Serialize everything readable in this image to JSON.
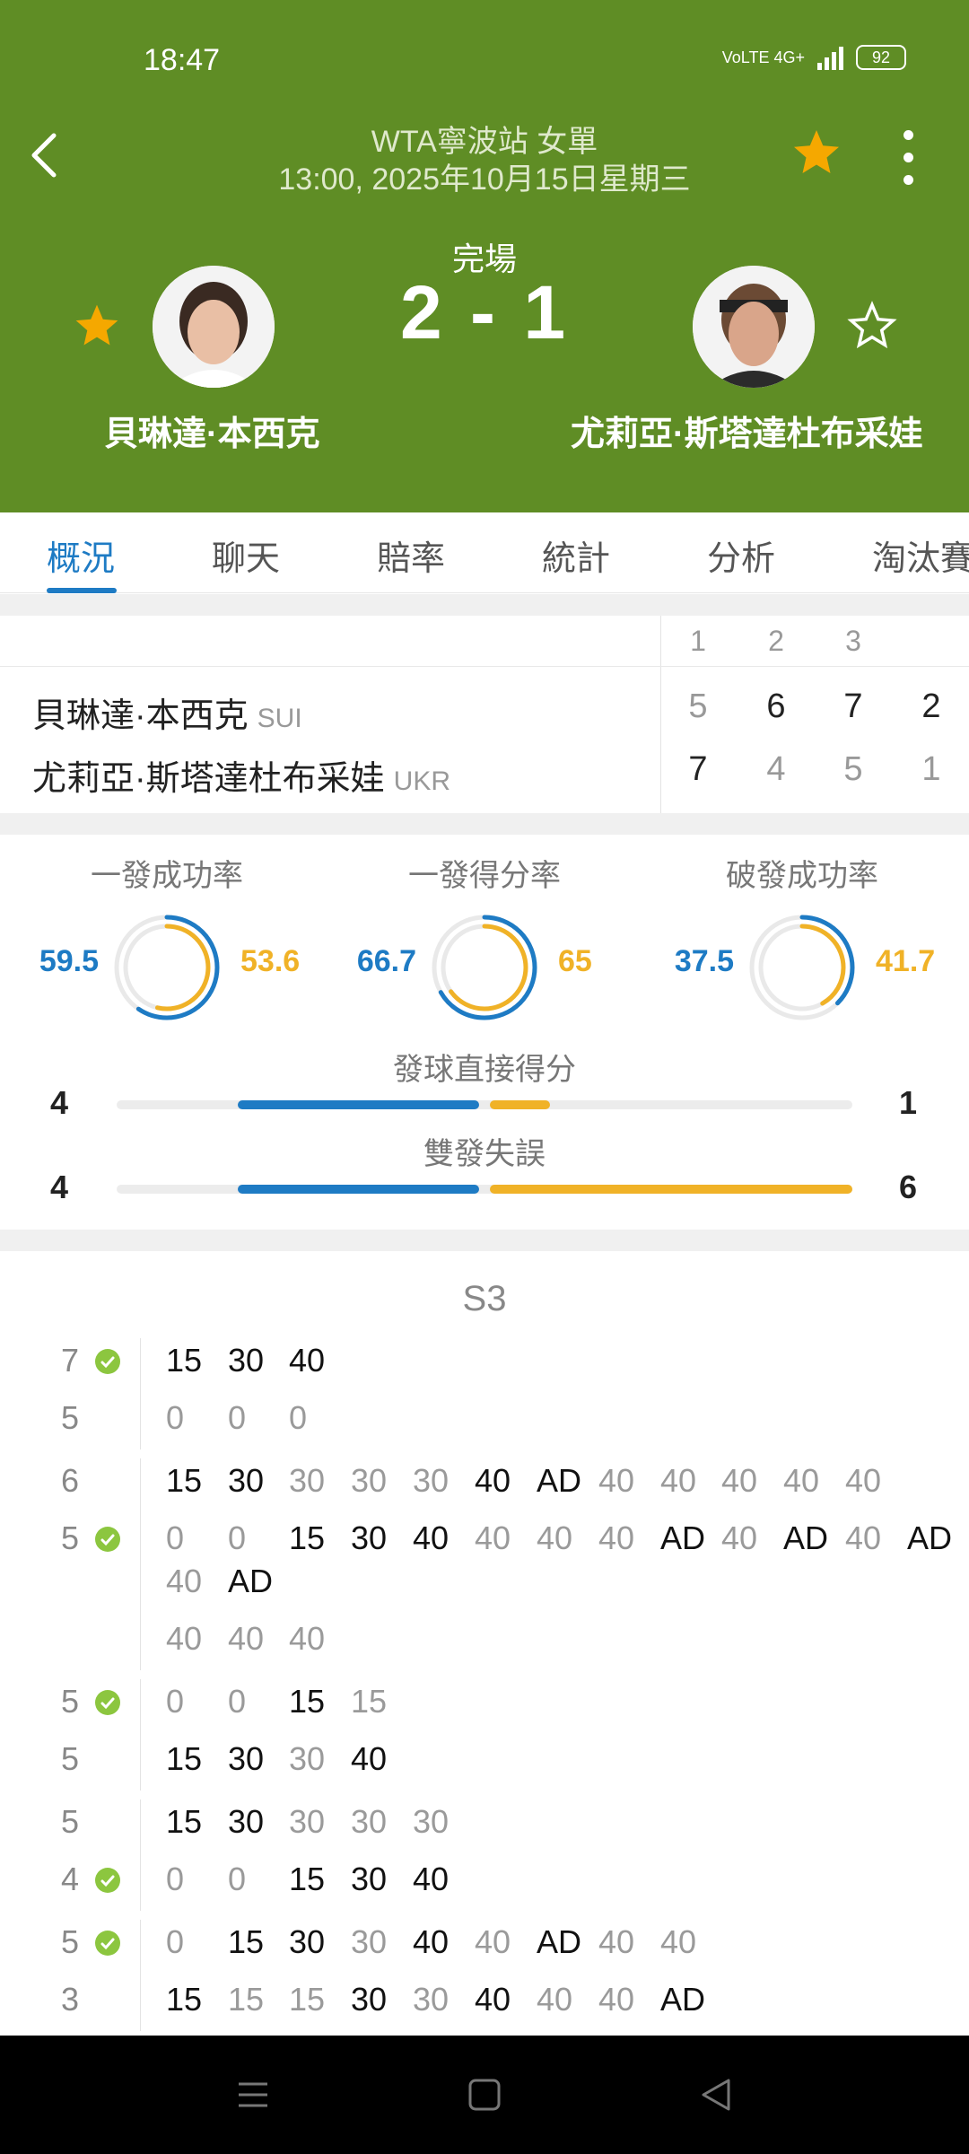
{
  "status_bar": {
    "time": "18:47",
    "network": "VoLTE 4G+",
    "battery": "92"
  },
  "header": {
    "tournament": "WTA寧波站 女單",
    "datetime": "13:00, 2025年10月15日星期三",
    "match_status": "完場",
    "score": "2 - 1",
    "player1": {
      "name": "貝琳達·本西克",
      "favorited": true
    },
    "player2": {
      "name": "尤莉亞·斯塔達杜布采娃",
      "favorited": false
    }
  },
  "tabs": [
    "概況",
    "聊天",
    "賠率",
    "統計",
    "分析",
    "淘汰賽"
  ],
  "scoreboard": {
    "set_headers": [
      "1",
      "2",
      "3"
    ],
    "rows": [
      {
        "name": "貝琳達·本西克",
        "country": "SUI",
        "sets": [
          "5",
          "6",
          "7"
        ],
        "total": "2"
      },
      {
        "name": "尤莉亞·斯塔達杜布采娃",
        "country": "UKR",
        "sets": [
          "7",
          "4",
          "5"
        ],
        "total": "1"
      }
    ]
  },
  "stats": {
    "rings": [
      {
        "title": "一發成功率",
        "left": "59.5",
        "right": "53.6"
      },
      {
        "title": "一發得分率",
        "left": "66.7",
        "right": "65"
      },
      {
        "title": "破發成功率",
        "left": "37.5",
        "right": "41.7"
      }
    ],
    "bars": [
      {
        "title": "發球直接得分",
        "left": "4",
        "right": "1"
      },
      {
        "title": "雙發失誤",
        "left": "4",
        "right": "6"
      }
    ]
  },
  "play_by_play": {
    "set_label": "S3",
    "games": [
      {
        "top_score": "7",
        "bottom_score": "5",
        "server": "top",
        "top_points": [
          "15",
          "30",
          "40"
        ],
        "bottom_points": [
          "0",
          "0",
          "0"
        ],
        "top_won": [
          true,
          true,
          true
        ],
        "bottom_won": [
          false,
          false,
          false
        ]
      },
      {
        "top_score": "6",
        "bottom_score": "5",
        "server": "bottom",
        "top_points": [
          "15",
          "30",
          "30",
          "30",
          "30",
          "40",
          "AD",
          "40",
          "40",
          "40",
          "40",
          "40"
        ],
        "bottom_points": [
          "0",
          "0",
          "15",
          "30",
          "40",
          "40",
          "40",
          "40",
          "AD",
          "40",
          "AD",
          "40",
          "AD",
          "40",
          "AD"
        ],
        "extra_points": [
          "40",
          "40",
          "40"
        ]
      },
      {
        "top_score": "5",
        "bottom_score": "5",
        "server": "top",
        "top_points": [
          "0",
          "0",
          "15",
          "15"
        ],
        "bottom_points": [
          "15",
          "30",
          "30",
          "40"
        ]
      },
      {
        "top_score": "5",
        "bottom_score": "4",
        "server": "bottom",
        "top_points": [
          "15",
          "30",
          "30",
          "30",
          "30"
        ],
        "bottom_points": [
          "0",
          "0",
          "15",
          "30",
          "40"
        ]
      },
      {
        "top_score": "5",
        "bottom_score": "3",
        "server": "top",
        "top_points": [
          "0",
          "15",
          "30",
          "30",
          "40",
          "40",
          "AD",
          "40",
          "40"
        ],
        "bottom_points": [
          "15",
          "15",
          "15",
          "30",
          "30",
          "40",
          "40",
          "40",
          "AD"
        ]
      }
    ]
  },
  "colors": {
    "header_bg": "#5f8d25",
    "blue": "#1e7bc4",
    "orange": "#f0b227",
    "ball": "#8cc63f"
  }
}
